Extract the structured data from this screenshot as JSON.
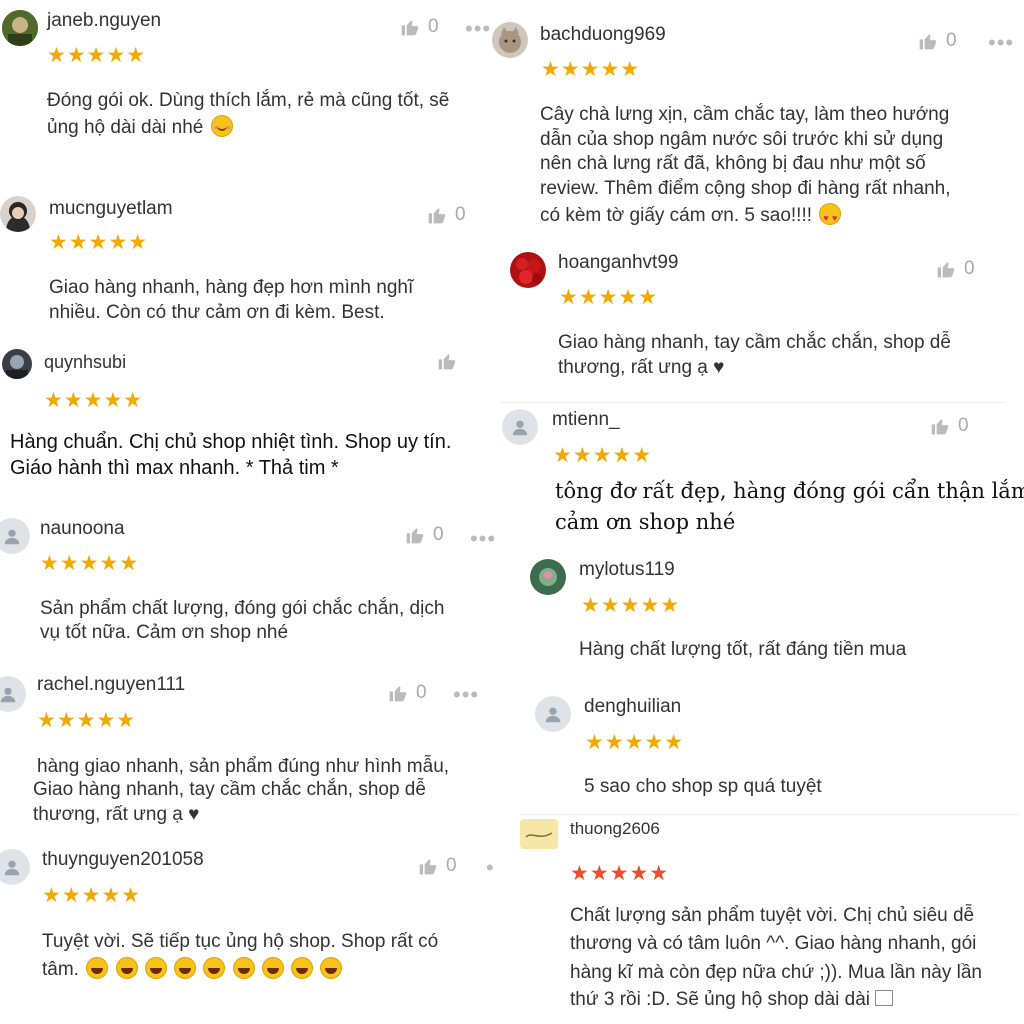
{
  "reviews_left": [
    {
      "username": "janeb.nguyen",
      "likes": "0",
      "stars": "★★★★★",
      "lines": [
        "Đóng gói ok. Dùng thích lắm, rẻ mà cũng tốt, sẽ",
        "ủng hộ dài dài nhé"
      ],
      "emoji": "smiling-face-with-hearts"
    },
    {
      "username": "mucnguyetlam",
      "likes": "0",
      "stars": "★★★★★",
      "lines": [
        "Giao hàng nhanh, hàng đẹp hơn mình nghĩ",
        "nhiều. Còn có thư cảm ơn đi kèm. Best."
      ]
    },
    {
      "username": "quynhsubi",
      "stars": "★★★★★",
      "lines": [
        "Hàng chuẩn. Chị chủ shop nhiệt tình. Shop uy tín.",
        "Giáo hành thì max nhanh. * Thả tim *"
      ]
    },
    {
      "username": "naunoona",
      "likes": "0",
      "stars": "★★★★★",
      "lines": [
        "Sản phẩm chất lượng, đóng gói chắc chắn, dịch",
        "vụ tốt nữa. Cảm ơn shop nhé"
      ]
    },
    {
      "username": "rachel.nguyen111",
      "likes": "0",
      "stars": "★★★★★",
      "lines": [
        "hàng giao nhanh, sản phẩm đúng như hình mẫu,",
        "Giao hàng nhanh, tay cầm chắc chắn, shop dễ",
        "thương, rất ưng ạ ♥"
      ]
    },
    {
      "username": "thuynguyen201058",
      "likes": "0",
      "stars": "★★★★★",
      "lines": [
        "Tuyệt vời. Sẽ tiếp tục ủng hộ shop. Shop rất có",
        "tâm."
      ],
      "emoji_count": 9
    }
  ],
  "reviews_right": [
    {
      "username": "bachduong969",
      "likes": "0",
      "stars": "★★★★★",
      "lines": [
        "Cây chà lưng xịn, cầm chắc tay, làm theo hướng",
        "dẫn của shop ngâm nước sôi trước khi sử dụng",
        "nên chà lưng rất đã, không bị đau như một số",
        "review. Thêm điểm cộng shop đi hàng rất nhanh,",
        "có kèm tờ giấy cám ơn. 5 sao!!!!"
      ],
      "emoji": "heart-eyes"
    },
    {
      "username": "hoanganhvt99",
      "likes": "0",
      "stars": "★★★★★",
      "lines": [
        "Giao hàng nhanh, tay cầm chắc chắn, shop dễ",
        "thương, rất ưng ạ ♥"
      ]
    },
    {
      "username": "mtienn_",
      "likes": "0",
      "stars": "★★★★★",
      "lines": [
        "tông đơ rất đẹp, hàng đóng gói cẩn thận lắm",
        "cảm ơn shop nhé"
      ]
    },
    {
      "username": "mylotus119",
      "stars": "★★★★★",
      "lines": [
        "Hàng chất lượng tốt, rất đáng tiền mua"
      ]
    },
    {
      "username": "denghuilian",
      "stars": "★★★★★",
      "lines": [
        "5 sao cho shop sp quá tuyệt"
      ]
    },
    {
      "username": "thuong2606",
      "stars": "★★★★★",
      "lines": [
        "Chất lượng sản phẩm tuyệt vời. Chị chủ siêu dễ",
        "thương và có tâm luôn ^^. Giao hàng nhanh, gói",
        "hàng kĩ mà còn đẹp nữa chứ ;)). Mua lần này lần",
        "thứ 3 rồi :D. Sẽ ủng hộ shop dài dài"
      ]
    }
  ],
  "more_label": "•••",
  "colors": {
    "star": "#f2a900",
    "star_alt": "#ee4d2d",
    "text": "#333333",
    "muted": "#aaaaaa"
  }
}
